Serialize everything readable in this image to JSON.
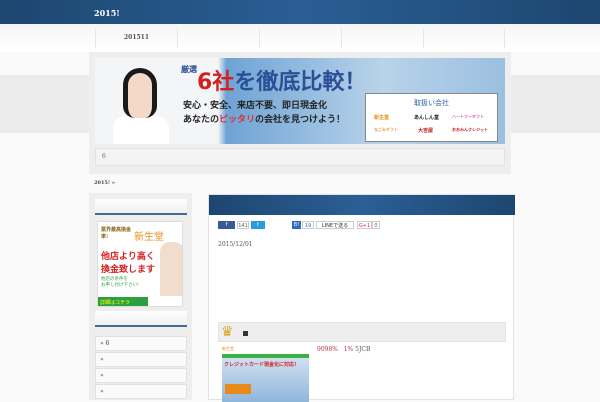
{
  "header": {
    "title": "2015!"
  },
  "nav": {
    "items": [
      "201511",
      "",
      "",
      "",
      ""
    ]
  },
  "banner": {
    "headline_prefix": "厳選",
    "headline_num": "6社",
    "headline_rest": "を徹底比較！",
    "line2": "安心・安全、来店不要、即日現金化",
    "line3_a": "あなたの",
    "line3_b": "ピッタリ",
    "line3_c": "の会社を見つけよう！",
    "companies_title": "取扱い会社",
    "companies": [
      "新生堂",
      "あんしん堂",
      "ハートフーギフト",
      "なごみギフト",
      "大吉屋",
      "おおみんクレジット"
    ]
  },
  "breadcrumb_box": "6",
  "breadcrumb": "2015! »",
  "sidebar": {
    "ad": {
      "l1": "業界最高換金率!",
      "brand": "新生堂",
      "l2": "他店より高く",
      "l3": "換金致します",
      "l4": "他店の条件を",
      "l5": "お申し付け下さい!",
      "cta": "詳細はコチラ"
    },
    "links": [
      "» 6",
      "»",
      "»",
      "»"
    ]
  },
  "main": {
    "share": {
      "fb": "f",
      "fb_count": "141",
      "tw": "t",
      "hatena": "B!",
      "hatena_count": "19",
      "line": "LINEで送る",
      "gplus": "G+1",
      "gplus_count": "0"
    },
    "date": "2015/12/01",
    "rank_marker": "■",
    "rate": "9098%",
    "rate2": "1%",
    "cards": "5JCB",
    "shot_text": "クレジットカード現金化に対応！"
  },
  "colors": {
    "header": "#1d4670",
    "accent_red": "#d42020"
  }
}
